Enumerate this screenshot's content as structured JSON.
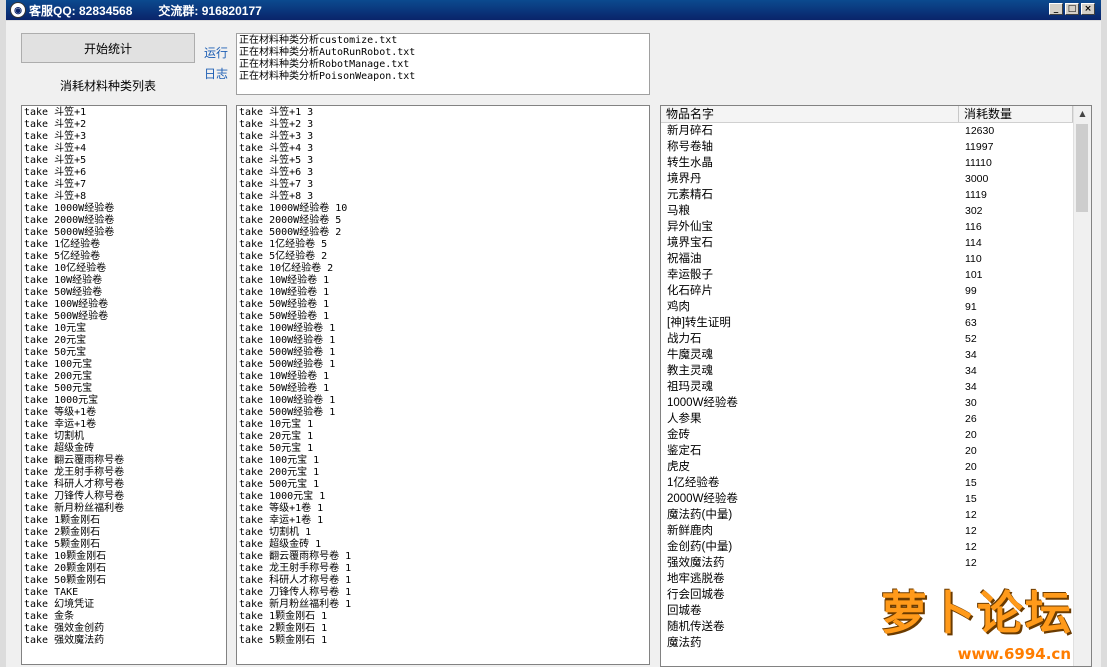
{
  "window": {
    "title_left": "客服QQ: 82834568",
    "title_right": "交流群: 916820177",
    "min": "_",
    "max": "□",
    "close": "×"
  },
  "toolbar": {
    "start_label": "开始统计",
    "list_title": "消耗材料种类列表",
    "log_label": "运行日志"
  },
  "log_lines": [
    "正在材料种类分析customize.txt",
    "正在材料种类分析AutoRunRobot.txt",
    "正在材料种类分析RobotManage.txt",
    "正在材料种类分析PoisonWeapon.txt"
  ],
  "left_list": [
    "take 斗笠+1",
    "take 斗笠+2",
    "take 斗笠+3",
    "take 斗笠+4",
    "take 斗笠+5",
    "take 斗笠+6",
    "take 斗笠+7",
    "take 斗笠+8",
    "take 1000W经验卷",
    "take 2000W经验卷",
    "take 5000W经验卷",
    "take 1亿经验卷",
    "take 5亿经验卷",
    "take 10亿经验卷",
    "take 10W经验卷",
    "take 50W经验卷",
    "take 100W经验卷",
    "take 500W经验卷",
    "take 10元宝",
    "take 20元宝",
    "take 50元宝",
    "take 100元宝",
    "take 200元宝",
    "take 500元宝",
    "take 1000元宝",
    "take 等级+1卷",
    "take 幸运+1卷",
    "take 切割机",
    "take 超级金砖",
    "take 翻云覆雨称号卷",
    "take 龙王射手称号卷",
    "take 科研人才称号卷",
    "take 刀锋传人称号卷",
    "take 新月粉丝福利卷",
    "take 1颗金刚石",
    "take 2颗金刚石",
    "take 5颗金刚石",
    "take 10颗金刚石",
    "take 20颗金刚石",
    "take 50颗金刚石",
    "take TAKE",
    "take 幻境凭证",
    "take 金条",
    "take 强效金创药",
    "take 强效魔法药"
  ],
  "mid_list": [
    "take 斗笠+1 3",
    "take 斗笠+2 3",
    "take 斗笠+3 3",
    "take 斗笠+4 3",
    "take 斗笠+5 3",
    "take 斗笠+6 3",
    "take 斗笠+7 3",
    "take 斗笠+8 3",
    "take 1000W经验卷 10",
    "take 2000W经验卷 5",
    "take 5000W经验卷 2",
    "take 1亿经验卷 5",
    "take 5亿经验卷 2",
    "take 10亿经验卷 2",
    "take 10W经验卷 1",
    "take 10W经验卷 1",
    "take 50W经验卷 1",
    "take 50W经验卷 1",
    "take 100W经验卷 1",
    "take 100W经验卷 1",
    "take 500W经验卷 1",
    "take 500W经验卷 1",
    "take 10W经验卷 1",
    "take 50W经验卷 1",
    "take 100W经验卷 1",
    "take 500W经验卷 1",
    "take 10元宝 1",
    "take 20元宝 1",
    "take 50元宝 1",
    "take 100元宝 1",
    "take 200元宝 1",
    "take 500元宝 1",
    "take 1000元宝 1",
    "take 等级+1卷 1",
    "take 幸运+1卷 1",
    "take 切割机 1",
    "take 超级金砖 1",
    "take 翻云覆雨称号卷 1",
    "take 龙王射手称号卷 1",
    "take 科研人才称号卷 1",
    "take 刀锋传人称号卷 1",
    "take 新月粉丝福利卷 1",
    "take 1颗金刚石 1",
    "take 2颗金刚石 1",
    "take 5颗金刚石 1"
  ],
  "table": {
    "headers": [
      "物品名字",
      "消耗数量"
    ],
    "rows": [
      [
        "新月碎石",
        "12630"
      ],
      [
        "称号卷轴",
        "11997"
      ],
      [
        "转生水晶",
        "11110"
      ],
      [
        "境界丹",
        "3000"
      ],
      [
        "元素精石",
        "1119"
      ],
      [
        "马粮",
        "302"
      ],
      [
        "异外仙宝",
        "116"
      ],
      [
        "境界宝石",
        "114"
      ],
      [
        "祝福油",
        "110"
      ],
      [
        "幸运骰子",
        "101"
      ],
      [
        "化石碎片",
        "99"
      ],
      [
        "鸡肉",
        "91"
      ],
      [
        "[神]转生证明",
        "63"
      ],
      [
        "战力石",
        "52"
      ],
      [
        "牛魔灵魂",
        "34"
      ],
      [
        "教主灵魂",
        "34"
      ],
      [
        "祖玛灵魂",
        "34"
      ],
      [
        "1000W经验卷",
        "30"
      ],
      [
        "人参果",
        "26"
      ],
      [
        "金砖",
        "20"
      ],
      [
        "鉴定石",
        "20"
      ],
      [
        "虎皮",
        "20"
      ],
      [
        "1亿经验卷",
        "15"
      ],
      [
        "2000W经验卷",
        "15"
      ],
      [
        "魔法药(中量)",
        "12"
      ],
      [
        "新鲜鹿肉",
        "12"
      ],
      [
        "金创药(中量)",
        "12"
      ],
      [
        "强效魔法药",
        "12"
      ],
      [
        "地牢逃脱卷",
        ""
      ],
      [
        "行会回城卷",
        ""
      ],
      [
        "回城卷",
        ""
      ],
      [
        "随机传送卷",
        ""
      ],
      [
        "魔法药",
        ""
      ]
    ]
  },
  "scroll": {
    "up": "▲"
  },
  "watermark": {
    "text": "萝卜论坛",
    "url": "www.6994.cn"
  }
}
